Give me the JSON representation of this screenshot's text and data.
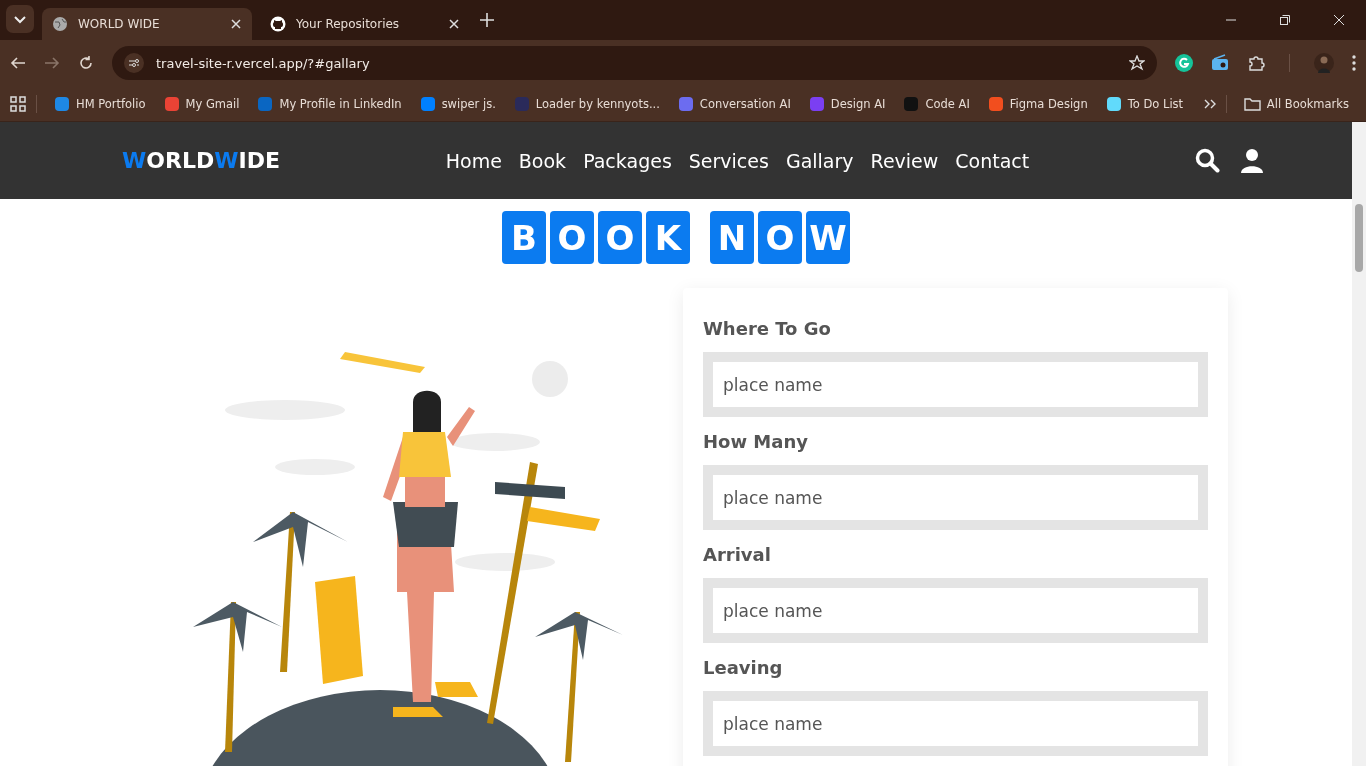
{
  "browser": {
    "tabs": [
      {
        "title": "WORLD WIDE",
        "selected": true
      },
      {
        "title": "Your Repositories",
        "selected": false
      }
    ],
    "url": "travel-site-r.vercel.app/?#gallary",
    "bookmarks": [
      {
        "label": "HM Portfolio",
        "color": "#1e88e5"
      },
      {
        "label": "My Gmail",
        "color": "#ea4335"
      },
      {
        "label": "My Profile in LinkedIn",
        "color": "#0a66c2"
      },
      {
        "label": "swiper js.",
        "color": "#0080ff"
      },
      {
        "label": "Loader by kennyots...",
        "color": "#2a2a5a"
      },
      {
        "label": "Conversation AI",
        "color": "#6c6cf0"
      },
      {
        "label": "Design AI",
        "color": "#7b3ff2"
      },
      {
        "label": "Code AI",
        "color": "#111111"
      },
      {
        "label": "Figma Design",
        "color": "#f24e1e"
      },
      {
        "label": "To Do List",
        "color": "#61dafb"
      }
    ],
    "all_bookmarks": "All Bookmarks"
  },
  "site": {
    "logo": [
      {
        "text": "W",
        "accent": true
      },
      {
        "text": "ORLD",
        "accent": false
      },
      {
        "text": "W",
        "accent": true
      },
      {
        "text": "IDE",
        "accent": false
      }
    ],
    "nav": [
      "Home",
      "Book",
      "Packages",
      "Services",
      "Gallary",
      "Review",
      "Contact"
    ],
    "heading": [
      [
        "B",
        "O",
        "O",
        "K"
      ],
      [
        "N",
        "O",
        "W"
      ]
    ],
    "form": {
      "fields": [
        {
          "label": "Where To Go",
          "placeholder": "place name"
        },
        {
          "label": "How Many",
          "placeholder": "place name"
        },
        {
          "label": "Arrival",
          "placeholder": "place name"
        },
        {
          "label": "Leaving",
          "placeholder": "place name"
        }
      ]
    }
  }
}
